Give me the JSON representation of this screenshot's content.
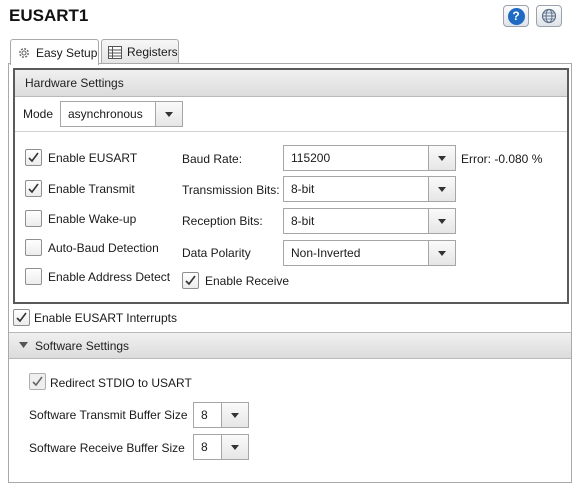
{
  "header": {
    "title": "EUSART1",
    "help_icon": "help-icon",
    "globe_icon": "globe-icon"
  },
  "tabs": [
    {
      "label": "Easy Setup",
      "icon": "gear-icon",
      "active": true
    },
    {
      "label": "Registers",
      "icon": "table-icon",
      "active": false
    }
  ],
  "hardware": {
    "section_title": "Hardware Settings",
    "mode_label": "Mode",
    "mode_value": "asynchronous",
    "checkboxes": [
      {
        "label": "Enable EUSART",
        "checked": true
      },
      {
        "label": "Enable Transmit",
        "checked": true
      },
      {
        "label": "Enable Wake-up",
        "checked": false
      },
      {
        "label": "Auto-Baud Detection",
        "checked": false
      },
      {
        "label": "Enable Address Detect",
        "checked": false
      }
    ],
    "baud_label": "Baud Rate:",
    "baud_value": "115200",
    "error_text": "Error: -0.080 %",
    "tx_bits_label": "Transmission Bits:",
    "tx_bits_value": "8-bit",
    "rx_bits_label": "Reception Bits:",
    "rx_bits_value": "8-bit",
    "polarity_label": "Data Polarity",
    "polarity_value": "Non-Inverted",
    "enable_receive_label": "Enable Receive",
    "enable_receive_checked": true
  },
  "interrupts": {
    "label": "Enable EUSART Interrupts",
    "checked": true
  },
  "software": {
    "section_title": "Software Settings",
    "redirect_label": "Redirect STDIO to USART",
    "redirect_checked": true,
    "tx_buffer_label": "Software Transmit Buffer Size",
    "tx_buffer_value": "8",
    "rx_buffer_label": "Software Receive Buffer Size",
    "rx_buffer_value": "8"
  },
  "colors": {
    "accent": "#1f6bc4",
    "section_border": "#5a5a5a"
  }
}
